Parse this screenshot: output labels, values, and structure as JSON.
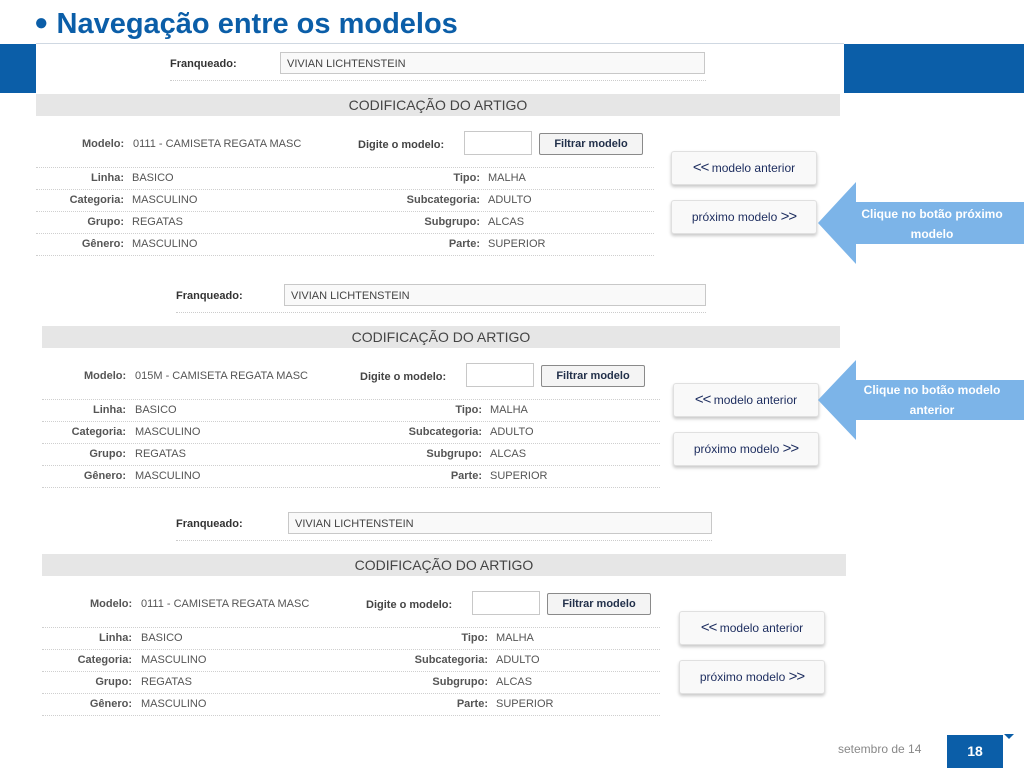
{
  "slide": {
    "title": "Navegação entre os modelos",
    "footer_date": "setembro de 14",
    "page_number": "18",
    "accent_color": "#0b5ea8",
    "callout_color": "#7cb4e8"
  },
  "panels": [
    {
      "franqueado_label": "Franqueado:",
      "franqueado_value": "VIVIAN LICHTENSTEIN",
      "section_title": "CODIFICAÇÃO DO ARTIGO",
      "modelo_label": "Modelo:",
      "modelo_value": "0111 - CAMISETA REGATA MASC",
      "digite_label": "Digite o modelo:",
      "filtrar_label": "Filtrar modelo",
      "rows": [
        {
          "l1": "Linha:",
          "v1": "BASICO",
          "l2": "Tipo:",
          "v2": "MALHA"
        },
        {
          "l1": "Categoria:",
          "v1": "MASCULINO",
          "l2": "Subcategoria:",
          "v2": "ADULTO"
        },
        {
          "l1": "Grupo:",
          "v1": "REGATAS",
          "l2": "Subgrupo:",
          "v2": "ALCAS"
        },
        {
          "l1": "Gênero:",
          "v1": "MASCULINO",
          "l2": "Parte:",
          "v2": "SUPERIOR"
        }
      ],
      "prev_arrows": "<<",
      "prev_label": "modelo anterior",
      "next_label": "próximo modelo",
      "next_arrows": ">>"
    },
    {
      "franqueado_label": "Franqueado:",
      "franqueado_value": "VIVIAN LICHTENSTEIN",
      "section_title": "CODIFICAÇÃO DO ARTIGO",
      "modelo_label": "Modelo:",
      "modelo_value": "015M - CAMISETA REGATA MASC",
      "digite_label": "Digite o modelo:",
      "filtrar_label": "Filtrar modelo",
      "rows": [
        {
          "l1": "Linha:",
          "v1": "BASICO",
          "l2": "Tipo:",
          "v2": "MALHA"
        },
        {
          "l1": "Categoria:",
          "v1": "MASCULINO",
          "l2": "Subcategoria:",
          "v2": "ADULTO"
        },
        {
          "l1": "Grupo:",
          "v1": "REGATAS",
          "l2": "Subgrupo:",
          "v2": "ALCAS"
        },
        {
          "l1": "Gênero:",
          "v1": "MASCULINO",
          "l2": "Parte:",
          "v2": "SUPERIOR"
        }
      ],
      "prev_arrows": "<<",
      "prev_label": "modelo anterior",
      "next_label": "próximo modelo",
      "next_arrows": ">>"
    },
    {
      "franqueado_label": "Franqueado:",
      "franqueado_value": "VIVIAN LICHTENSTEIN",
      "section_title": "CODIFICAÇÃO DO ARTIGO",
      "modelo_label": "Modelo:",
      "modelo_value": "0111 - CAMISETA REGATA MASC",
      "digite_label": "Digite o modelo:",
      "filtrar_label": "Filtrar modelo",
      "rows": [
        {
          "l1": "Linha:",
          "v1": "BASICO",
          "l2": "Tipo:",
          "v2": "MALHA"
        },
        {
          "l1": "Categoria:",
          "v1": "MASCULINO",
          "l2": "Subcategoria:",
          "v2": "ADULTO"
        },
        {
          "l1": "Grupo:",
          "v1": "REGATAS",
          "l2": "Subgrupo:",
          "v2": "ALCAS"
        },
        {
          "l1": "Gênero:",
          "v1": "MASCULINO",
          "l2": "Parte:",
          "v2": "SUPERIOR"
        }
      ],
      "prev_arrows": "<<",
      "prev_label": "modelo anterior",
      "next_label": "próximo modelo",
      "next_arrows": ">>"
    }
  ],
  "callouts": [
    {
      "text": "Clique no botão próximo modelo"
    },
    {
      "text": "Clique no botão modelo anterior"
    }
  ]
}
